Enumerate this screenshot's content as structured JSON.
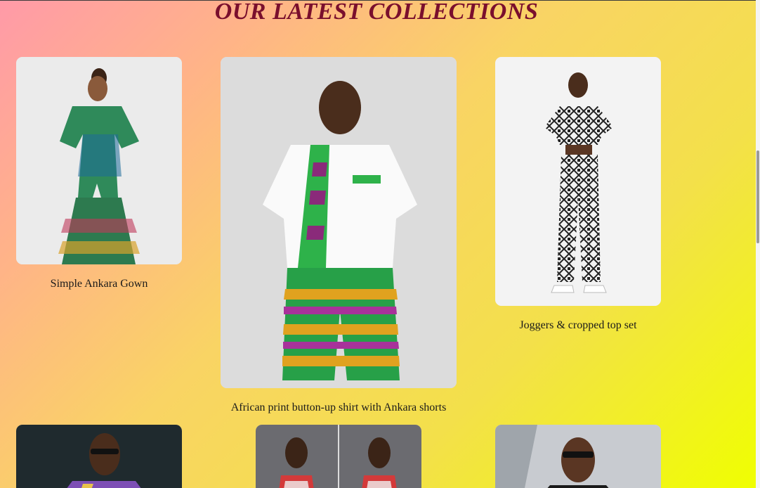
{
  "page": {
    "title": "OUR LATEST COLLECTIONS"
  },
  "products": [
    {
      "caption": "Simple Ankara Gown",
      "image": "green-ankara-mermaid-gown-photo"
    },
    {
      "caption": "African print button-up shirt with Ankara shorts",
      "image": "kente-print-shirt-and-shorts-photo"
    },
    {
      "caption": "Joggers & cropped top set",
      "image": "black-white-joggers-crop-top-photo"
    },
    {
      "caption": "",
      "image": "floral-blazer-man-photo"
    },
    {
      "caption": "",
      "image": "two-women-print-outfits-photo"
    },
    {
      "caption": "",
      "image": "man-sunglasses-black-shirt-photo"
    }
  ],
  "colors": {
    "title": "#7a0f2d",
    "gradient_start": "#ff9aa8",
    "gradient_end": "#f0ff00"
  }
}
